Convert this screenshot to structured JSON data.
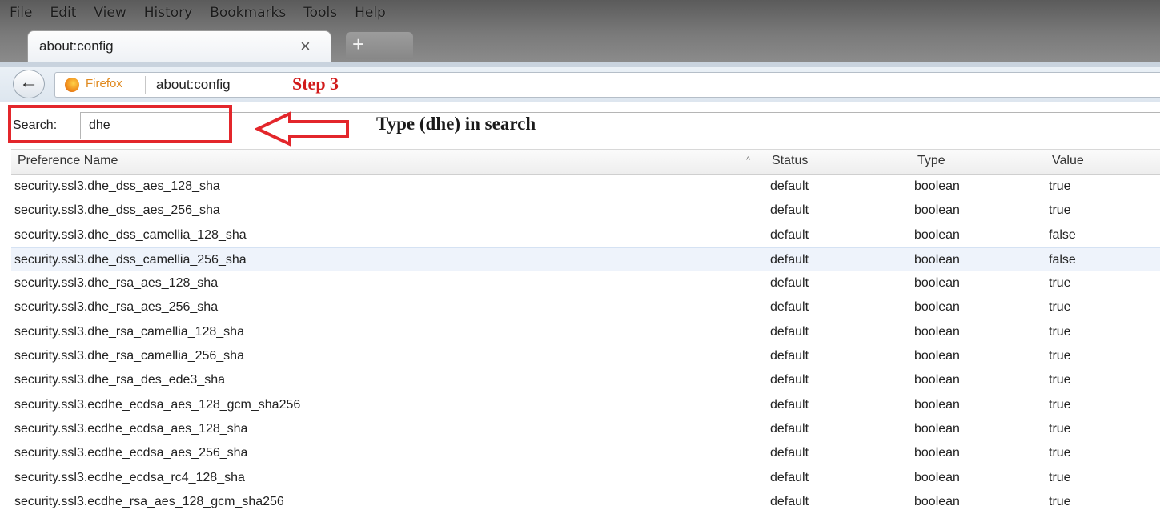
{
  "menu": [
    "File",
    "Edit",
    "View",
    "History",
    "Bookmarks",
    "Tools",
    "Help"
  ],
  "tab": {
    "title": "about:config",
    "close": "×",
    "new_tab": "+"
  },
  "nav": {
    "back": "←",
    "identity": "Firefox",
    "url": "about:config",
    "step_annotation": "Step 3"
  },
  "search": {
    "label": "Search:",
    "value": "dhe",
    "instruction": "Type (dhe) in search"
  },
  "table": {
    "columns": [
      "Preference Name",
      "Status",
      "Type",
      "Value"
    ],
    "sort_indicator": "^",
    "rows": [
      {
        "name": "security.ssl3.dhe_dss_aes_128_sha",
        "status": "default",
        "type": "boolean",
        "value": "true"
      },
      {
        "name": "security.ssl3.dhe_dss_aes_256_sha",
        "status": "default",
        "type": "boolean",
        "value": "true"
      },
      {
        "name": "security.ssl3.dhe_dss_camellia_128_sha",
        "status": "default",
        "type": "boolean",
        "value": "false"
      },
      {
        "name": "security.ssl3.dhe_dss_camellia_256_sha",
        "status": "default",
        "type": "boolean",
        "value": "false"
      },
      {
        "name": "security.ssl3.dhe_rsa_aes_128_sha",
        "status": "default",
        "type": "boolean",
        "value": "true"
      },
      {
        "name": "security.ssl3.dhe_rsa_aes_256_sha",
        "status": "default",
        "type": "boolean",
        "value": "true"
      },
      {
        "name": "security.ssl3.dhe_rsa_camellia_128_sha",
        "status": "default",
        "type": "boolean",
        "value": "true"
      },
      {
        "name": "security.ssl3.dhe_rsa_camellia_256_sha",
        "status": "default",
        "type": "boolean",
        "value": "true"
      },
      {
        "name": "security.ssl3.dhe_rsa_des_ede3_sha",
        "status": "default",
        "type": "boolean",
        "value": "true"
      },
      {
        "name": "security.ssl3.ecdhe_ecdsa_aes_128_gcm_sha256",
        "status": "default",
        "type": "boolean",
        "value": "true"
      },
      {
        "name": "security.ssl3.ecdhe_ecdsa_aes_128_sha",
        "status": "default",
        "type": "boolean",
        "value": "true"
      },
      {
        "name": "security.ssl3.ecdhe_ecdsa_aes_256_sha",
        "status": "default",
        "type": "boolean",
        "value": "true"
      },
      {
        "name": "security.ssl3.ecdhe_ecdsa_rc4_128_sha",
        "status": "default",
        "type": "boolean",
        "value": "true"
      },
      {
        "name": "security.ssl3.ecdhe_rsa_aes_128_gcm_sha256",
        "status": "default",
        "type": "boolean",
        "value": "true"
      }
    ]
  },
  "colors": {
    "annotation_red": "#e3262b",
    "step_red": "#d11a1a"
  }
}
